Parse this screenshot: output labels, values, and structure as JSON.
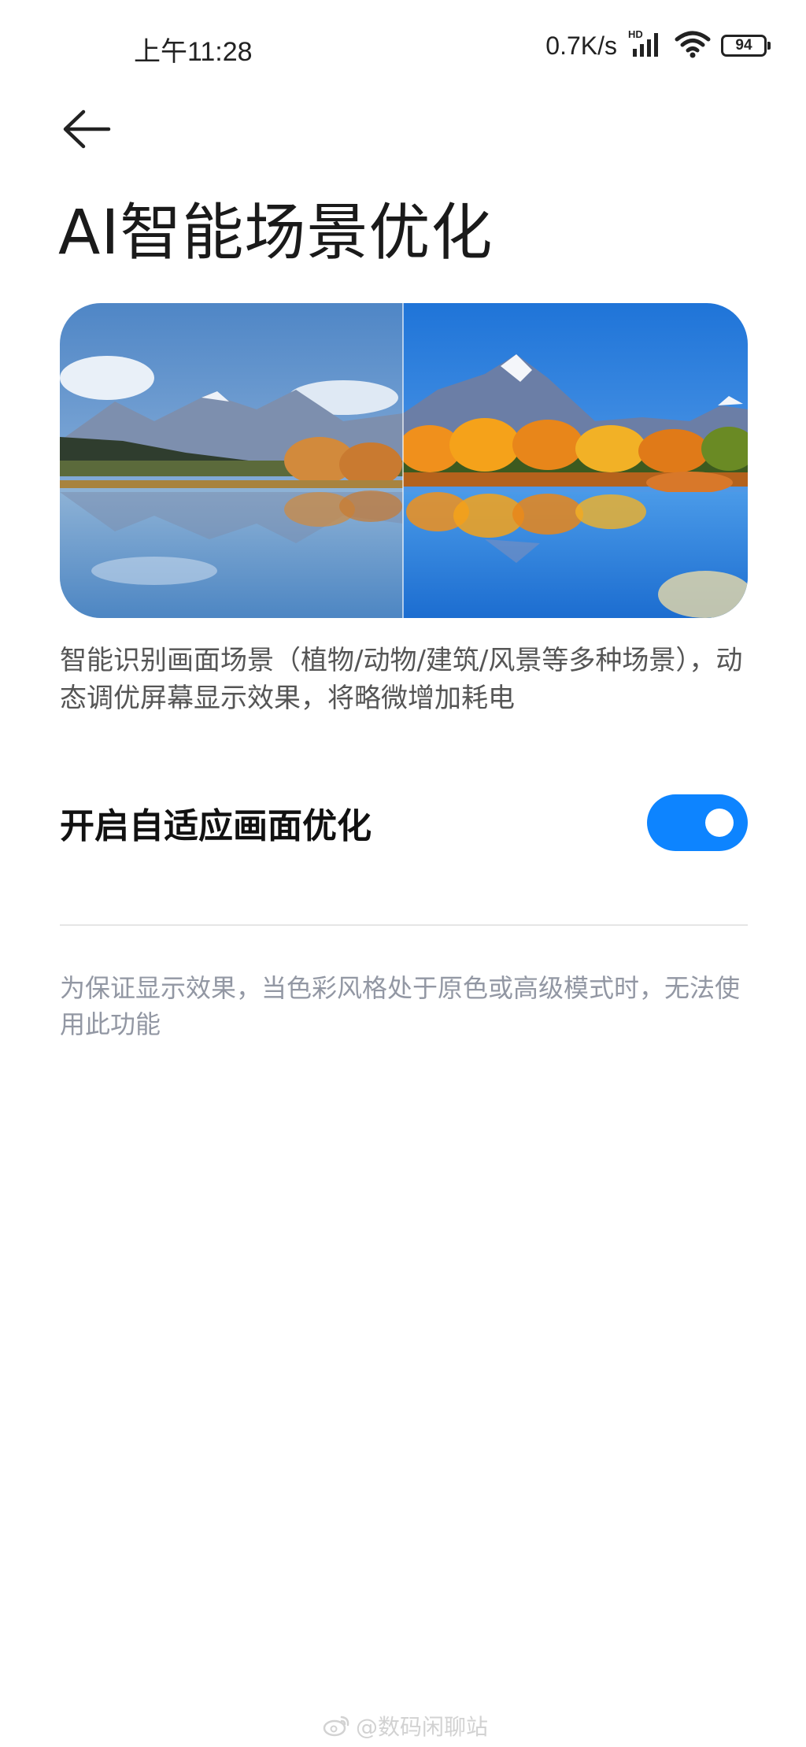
{
  "status_bar": {
    "time": "上午11:28",
    "network_speed": "0.7K/s",
    "signal_badge": "HD",
    "battery_level": "94",
    "icons": [
      "signal-icon",
      "wifi-icon",
      "battery-icon"
    ]
  },
  "header": {
    "back_icon": "back-arrow-icon",
    "title": "AI智能场景优化"
  },
  "preview": {
    "description": "智能识别画面场景（植物/动物/建筑/风景等多种场景），动态调优屏幕显示效果，将略微增加耗电"
  },
  "setting": {
    "label": "开启自适应画面优化",
    "enabled": true
  },
  "note": "为保证显示效果，当色彩风格处于原色或高级模式时，无法使用此功能",
  "watermark": "@数码闲聊站",
  "colors": {
    "accent": "#0d84ff",
    "note_text": "#9297a3",
    "description_text": "#555555"
  }
}
